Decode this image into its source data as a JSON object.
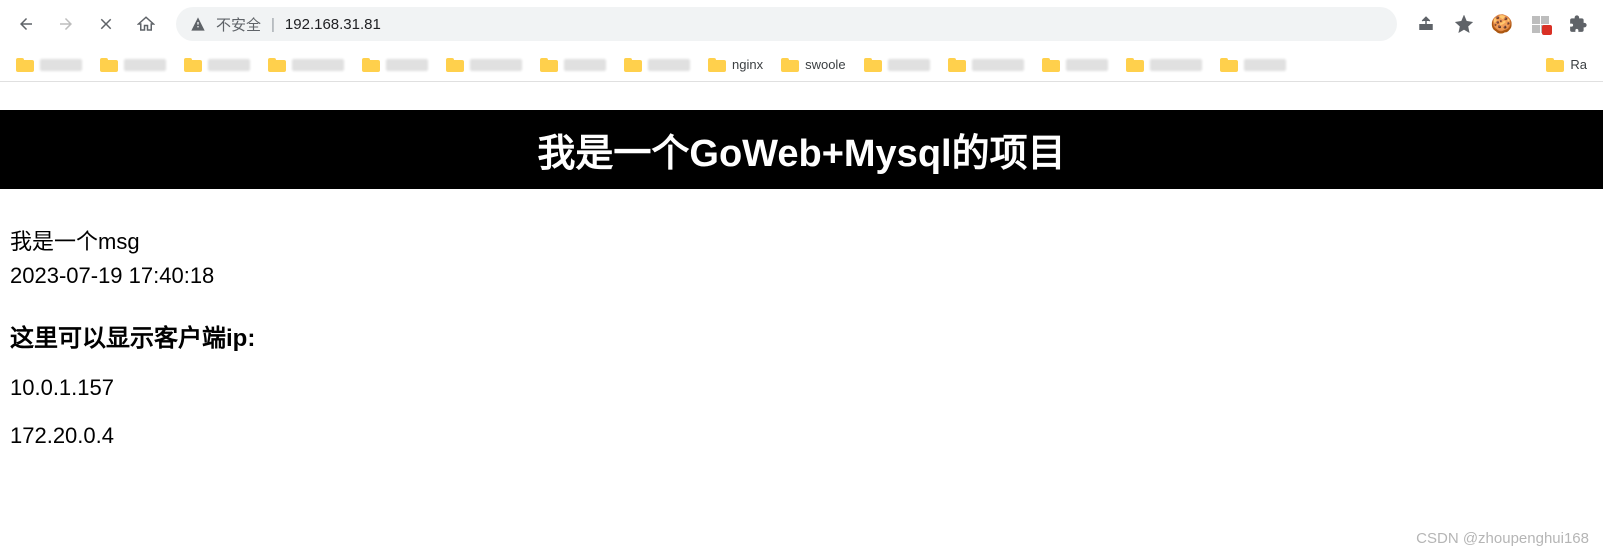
{
  "browser": {
    "not_secure_label": "不安全",
    "url": "192.168.31.81"
  },
  "bookmarks": [
    {
      "label": ""
    },
    {
      "label": ""
    },
    {
      "label": ""
    },
    {
      "label": ""
    },
    {
      "label": ""
    },
    {
      "label": ""
    },
    {
      "label": ""
    },
    {
      "label": ""
    },
    {
      "label": "nginx"
    },
    {
      "label": "swoole"
    },
    {
      "label": ""
    },
    {
      "label": ""
    },
    {
      "label": ""
    },
    {
      "label": ""
    },
    {
      "label": ""
    }
  ],
  "bookmarks_end": "Ra",
  "page": {
    "heading": "我是一个GoWeb+Mysql的项目",
    "msg": "我是一个msg",
    "timestamp": "2023-07-19 17:40:18",
    "client_ip_title": "这里可以显示客户端ip:",
    "ips": [
      "10.0.1.157",
      "172.20.0.4"
    ]
  },
  "watermark": "CSDN @zhoupenghui168"
}
